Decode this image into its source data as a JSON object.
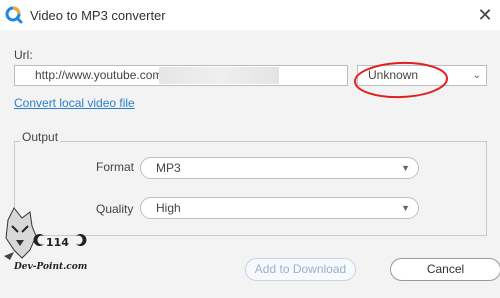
{
  "window": {
    "title": "Video to MP3 converter",
    "close_glyph": "✕"
  },
  "url": {
    "label": "Url:",
    "value": "http://www.youtube.com/"
  },
  "source_select": {
    "value": "Unknown",
    "chevron": "⌄"
  },
  "local_link": "Convert local video file",
  "output": {
    "legend": "Output",
    "format": {
      "label": "Format",
      "value": "MP3",
      "caret": "▼"
    },
    "quality": {
      "label": "Quality",
      "value": "High",
      "caret": "▼"
    }
  },
  "buttons": {
    "download": "Add to Download",
    "cancel": "Cancel"
  },
  "watermark": {
    "text": "Dev-Point.com",
    "badge": "114"
  },
  "colors": {
    "link": "#2a7fd4",
    "highlight_circle": "#e02020",
    "icon_blue": "#1e88e5",
    "icon_orange": "#f5a623"
  }
}
